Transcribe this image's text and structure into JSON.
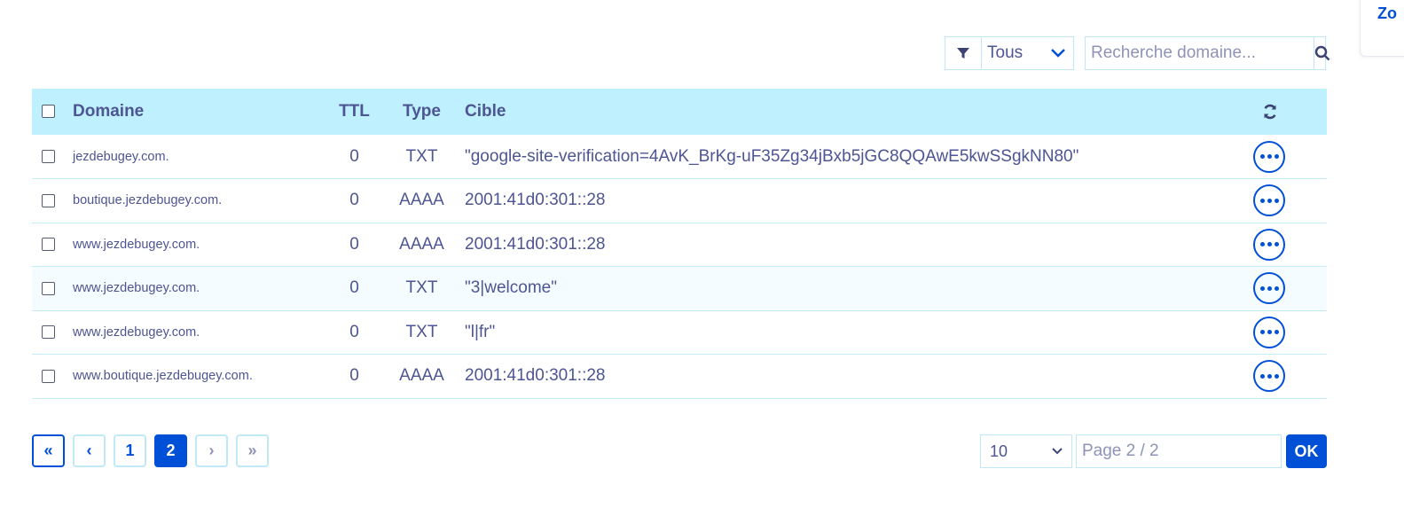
{
  "side_panel": {
    "text": "Zo"
  },
  "toolbar": {
    "filter_value": "Tous",
    "search_placeholder": "Recherche domaine..."
  },
  "table": {
    "headers": {
      "domain": "Domaine",
      "ttl": "TTL",
      "type": "Type",
      "target": "Cible"
    },
    "rows": [
      {
        "domain": "jezdebugey.com.",
        "ttl": "0",
        "type": "TXT",
        "target": "\"google-site-verification=4AvK_BrKg-uF35Zg34jBxb5jGC8QQAwE5kwSSgkNN80\""
      },
      {
        "domain": "boutique.jezdebugey.com.",
        "ttl": "0",
        "type": "AAAA",
        "target": "2001:41d0:301::28"
      },
      {
        "domain": "www.jezdebugey.com.",
        "ttl": "0",
        "type": "AAAA",
        "target": "2001:41d0:301::28"
      },
      {
        "domain": "www.jezdebugey.com.",
        "ttl": "0",
        "type": "TXT",
        "target": "\"3|welcome\""
      },
      {
        "domain": "www.jezdebugey.com.",
        "ttl": "0",
        "type": "TXT",
        "target": "\"l|fr\""
      },
      {
        "domain": "www.boutique.jezdebugey.com.",
        "ttl": "0",
        "type": "AAAA",
        "target": "2001:41d0:301::28"
      }
    ]
  },
  "pagination": {
    "first": "«",
    "prev": "‹",
    "pages": [
      "1",
      "2"
    ],
    "current_page": "2",
    "next": "›",
    "last": "»",
    "per_page": "10",
    "page_input_placeholder": "Page 2 / 2",
    "ok_label": "OK"
  },
  "icons": {
    "filter": "filter-icon",
    "dropdown": "chevron-down-icon",
    "search": "search-icon",
    "refresh": "refresh-icon",
    "row_actions": "more-horizontal-icon"
  },
  "colors": {
    "primary": "#0050d7",
    "header_bg": "#bef0fd",
    "text": "#4d5592",
    "border": "#bfe9f7"
  }
}
